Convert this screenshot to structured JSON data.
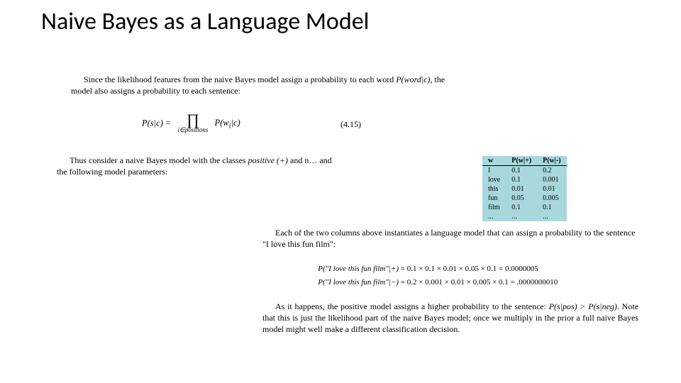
{
  "title": "Naive Bayes as a Language Model",
  "para1_a": "Since the likelihood features from the naive Bayes model assign a probability to each word ",
  "para1_b": "P(word|c)",
  "para1_c": ", the model also assigns a probability to each sentence:",
  "eq_lhs": "P(s|c) = ",
  "eq_prod_sub": "i∈positions",
  "eq_rhs": "P(w",
  "eq_rhs_sub": "i",
  "eq_rhs2": "|c)",
  "eq_num": "(4.15)",
  "para2_a": "Thus consider a naive Bayes model with the classes ",
  "para2_b": "positive (+)",
  "para2_c": " and n… and the following model parameters:",
  "table": {
    "headers": [
      "w",
      "P(w|+)",
      "P(w|-)"
    ],
    "rows": [
      [
        "I",
        "0.1",
        "0.2"
      ],
      [
        "love",
        "0.1",
        "0.001"
      ],
      [
        "this",
        "0.01",
        "0.01"
      ],
      [
        "fun",
        "0.05",
        "0.005"
      ],
      [
        "film",
        "0.1",
        "0.1"
      ],
      [
        "...",
        "...",
        "..."
      ]
    ]
  },
  "para3": "Each of the two columns above instantiates a language model that can assign a probability to the sentence \"I love this fun film\":",
  "calc": {
    "line1_lhs": "P(\"I love this fun film\"|+)",
    "line1_rhs": "=  0.1 × 0.1 × 0.01 × 0.05 × 0.1 = 0.0000005",
    "line2_lhs": "P(\"I love this fun film\"|−)",
    "line2_rhs": "=  0.2 × 0.001 × 0.01 × 0.005 × 0.1 = .0000000010"
  },
  "para4_a": "As it happens, the positive model assigns a higher probability to the sentence: ",
  "para4_b": "P(s|pos) > P(s|neg)",
  "para4_c": ". Note that this is just the likelihood part of the naive Bayes model; once we multiply in the prior a full naive Bayes model might well make a different classification decision.",
  "chart_data": {
    "type": "table",
    "title": "Naive Bayes word likelihood parameters",
    "columns": [
      "w",
      "P(w|+)",
      "P(w|-)"
    ],
    "rows": [
      {
        "w": "I",
        "P(w|+)": 0.1,
        "P(w|-)": 0.2
      },
      {
        "w": "love",
        "P(w|+)": 0.1,
        "P(w|-)": 0.001
      },
      {
        "w": "this",
        "P(w|+)": 0.01,
        "P(w|-)": 0.01
      },
      {
        "w": "fun",
        "P(w|+)": 0.05,
        "P(w|-)": 0.005
      },
      {
        "w": "film",
        "P(w|+)": 0.1,
        "P(w|-)": 0.1
      }
    ]
  }
}
